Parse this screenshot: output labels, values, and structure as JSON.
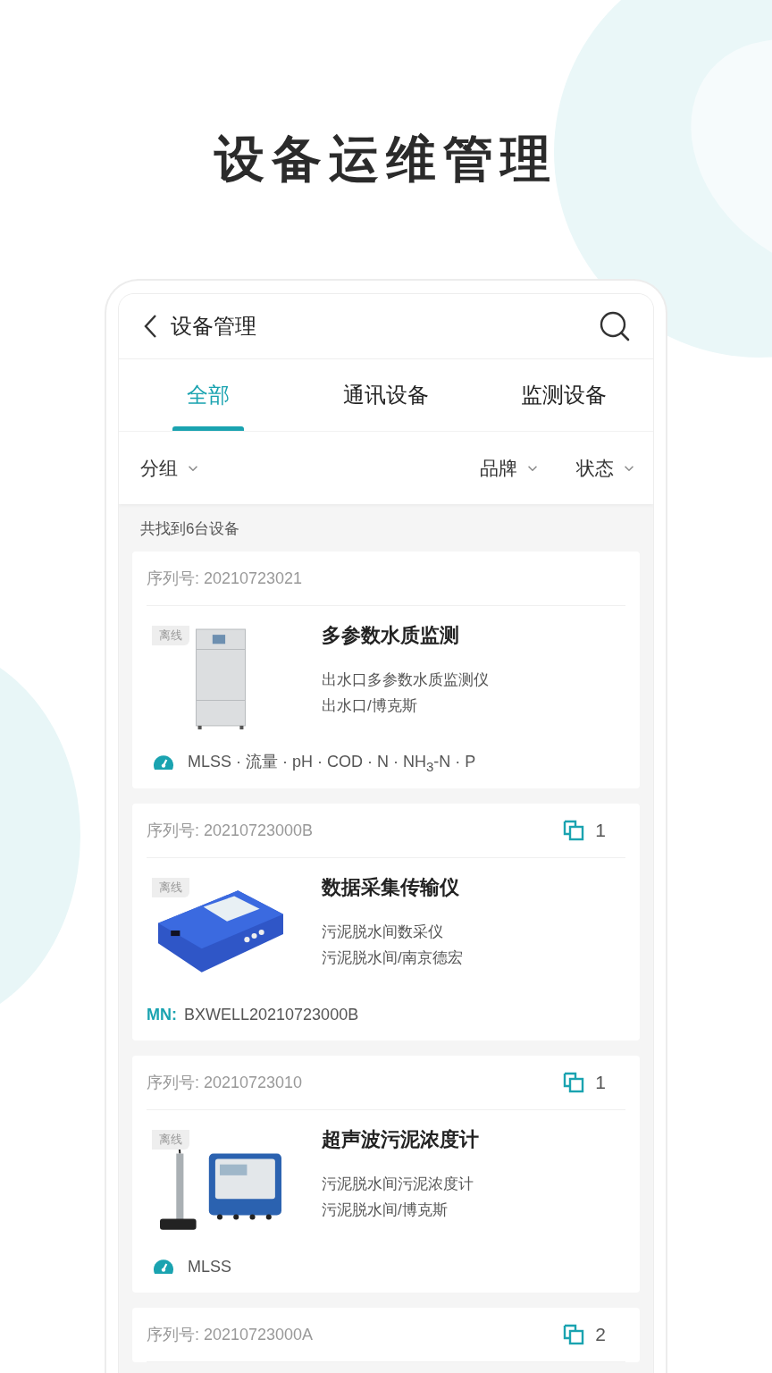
{
  "page_title": "设备运维管理",
  "header": {
    "title": "设备管理"
  },
  "tabs": [
    {
      "label": "全部",
      "selected": true
    },
    {
      "label": "通讯设备",
      "selected": false
    },
    {
      "label": "监测设备",
      "selected": false
    }
  ],
  "filters": [
    {
      "label": "分组"
    },
    {
      "label": "品牌"
    },
    {
      "label": "状态"
    }
  ],
  "result_count": "共找到6台设备",
  "devices": [
    {
      "serial": "序列号: 20210723021",
      "status": "离线",
      "image": {
        "kind": "cabinet"
      },
      "name": "多参数水质监测",
      "description": "出水口多参数水质监测仪",
      "location": "出水口/博克斯",
      "footer": {
        "kind": "params",
        "text": "MLSS · 流量 · pH · COD · N · NH$_{3}$-N · P"
      }
    },
    {
      "serial": "序列号: 20210723000B",
      "linked_count": "1",
      "status": "离线",
      "image": {
        "kind": "logger"
      },
      "name": "数据采集传输仪",
      "description": "污泥脱水间数采仪",
      "location": "污泥脱水间/南京德宏",
      "footer": {
        "kind": "mn",
        "label": "MN:",
        "value": "BXWELL20210723000B"
      }
    },
    {
      "serial": "序列号: 20210723010",
      "linked_count": "1",
      "status": "离线",
      "image": {
        "kind": "meter"
      },
      "name": "超声波污泥浓度计",
      "description": "污泥脱水间污泥浓度计",
      "location": "污泥脱水间/博克斯",
      "footer": {
        "kind": "params",
        "text": "MLSS"
      }
    },
    {
      "serial": "序列号: 20210723000A",
      "linked_count": "2"
    }
  ]
}
